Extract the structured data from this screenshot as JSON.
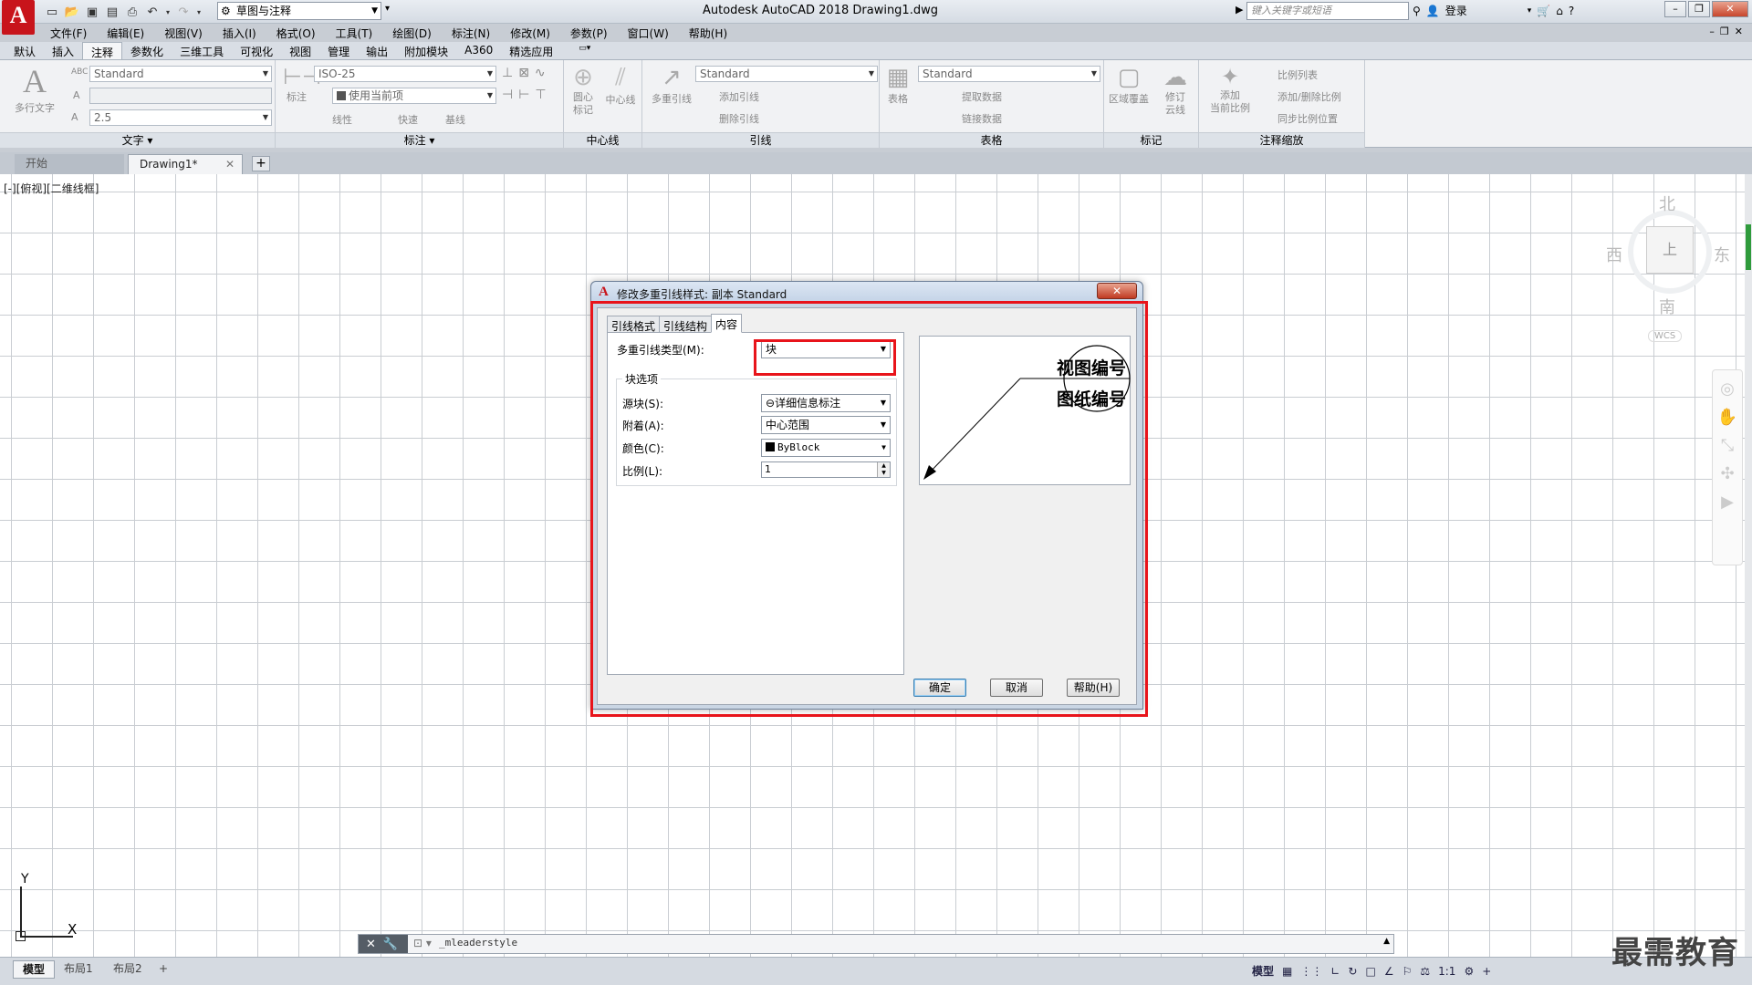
{
  "title_bar": {
    "workspace": "草图与注释",
    "app_title": "Autodesk AutoCAD 2018    Drawing1.dwg",
    "search_placeholder": "键入关键字或短语",
    "login": "登录"
  },
  "menu": [
    "文件(F)",
    "编辑(E)",
    "视图(V)",
    "插入(I)",
    "格式(O)",
    "工具(T)",
    "绘图(D)",
    "标注(N)",
    "修改(M)",
    "参数(P)",
    "窗口(W)",
    "帮助(H)"
  ],
  "ribbon_tabs": [
    {
      "label": "默认",
      "active": false
    },
    {
      "label": "插入",
      "active": false
    },
    {
      "label": "注释",
      "active": true
    },
    {
      "label": "参数化",
      "active": false
    },
    {
      "label": "三维工具",
      "active": false
    },
    {
      "label": "可视化",
      "active": false
    },
    {
      "label": "视图",
      "active": false
    },
    {
      "label": "管理",
      "active": false
    },
    {
      "label": "输出",
      "active": false
    },
    {
      "label": "附加模块",
      "active": false
    },
    {
      "label": "A360",
      "active": false
    },
    {
      "label": "精选应用",
      "active": false
    }
  ],
  "ribbon": {
    "text_panel": {
      "title": "文字 ▾",
      "big_label": "多行文字",
      "style": "Standard",
      "height": "2.5"
    },
    "dim_panel": {
      "title": "标注 ▾",
      "big_label": "标注",
      "style": "ISO-25",
      "layer": "使用当前项",
      "linear": "线性",
      "quick": "快速",
      "baseline": "基线"
    },
    "centerline_panel": {
      "title": "中心线",
      "center_mark": "圆心\n标记",
      "centerline": "中心线"
    },
    "leader_panel": {
      "title": "引线",
      "big_label": "多重引线",
      "style": "Standard",
      "add": "添加引线",
      "remove": "删除引线"
    },
    "table_panel": {
      "title": "表格",
      "big_label": "表格",
      "style": "Standard",
      "extract": "提取数据",
      "link": "链接数据"
    },
    "markup_panel": {
      "title": "标记",
      "wipeout": "区域覆盖",
      "revcloud": "修订\n云线"
    },
    "scale_panel": {
      "title": "注释缩放",
      "add_current": "添加\n当前比例",
      "scale_list": "比例列表",
      "add_delete": "添加/删除比例",
      "sync": "同步比例位置"
    }
  },
  "doc_tabs": {
    "start": "开始",
    "drawing": "Drawing1*"
  },
  "viewport_label": "[-][俯视][二维线框]",
  "viewcube": {
    "north": "北",
    "south": "南",
    "east": "东",
    "west": "西",
    "face": "上",
    "wcs": "WCS"
  },
  "ucs": {
    "x": "X",
    "y": "Y"
  },
  "command_line": {
    "text": "_mleaderstyle"
  },
  "layout_tabs": [
    "模型",
    "布局1",
    "布局2"
  ],
  "status": {
    "model": "模型",
    "scale": "1:1"
  },
  "watermark": "最需教育",
  "dialog": {
    "title": "修改多重引线样式: 副本 Standard",
    "tabs": [
      {
        "label": "引线格式",
        "active": false
      },
      {
        "label": "引线结构",
        "active": false
      },
      {
        "label": "内容",
        "active": true
      }
    ],
    "mleader_type_label": "多重引线类型(M):",
    "mleader_type_value": "块",
    "block_options_title": "块选项",
    "source_block_label": "源块(S):",
    "source_block_value": "详细信息标注",
    "attachment_label": "附着(A):",
    "attachment_value": "中心范围",
    "color_label": "颜色(C):",
    "color_value": "ByBlock",
    "scale_label": "比例(L):",
    "scale_value": "1",
    "preview_line1": "视图编号",
    "preview_line2": "图纸编号",
    "buttons": {
      "ok": "确定",
      "cancel": "取消",
      "help": "帮助(H)"
    }
  }
}
